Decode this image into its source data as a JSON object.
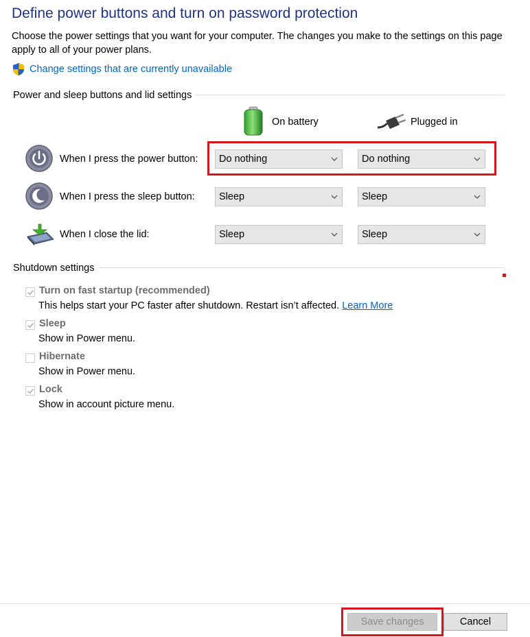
{
  "page": {
    "title": "Define power buttons and turn on password protection",
    "description": "Choose the power settings that you want for your computer. The changes you make to the settings on this page apply to all of your power plans.",
    "change_link": "Change settings that are currently unavailable"
  },
  "buttons_section": {
    "title": "Power and sleep buttons and lid settings",
    "columns": [
      "On battery",
      "Plugged in"
    ],
    "rows": [
      {
        "label": "When I press the power button:",
        "icon": "power-button-icon",
        "battery": "Do nothing",
        "plugged": "Do nothing"
      },
      {
        "label": "When I press the sleep button:",
        "icon": "sleep-button-icon",
        "battery": "Sleep",
        "plugged": "Sleep"
      },
      {
        "label": "When I close the lid:",
        "icon": "laptop-lid-icon",
        "battery": "Sleep",
        "plugged": "Sleep"
      }
    ]
  },
  "shutdown_section": {
    "title": "Shutdown settings",
    "options": [
      {
        "title": "Turn on fast startup (recommended)",
        "desc": "This helps start your PC faster after shutdown. Restart isn’t affected.",
        "link": "Learn More",
        "checked": true
      },
      {
        "title": "Sleep",
        "desc": "Show in Power menu.",
        "checked": true
      },
      {
        "title": "Hibernate",
        "desc": "Show in Power menu.",
        "checked": false
      },
      {
        "title": "Lock",
        "desc": "Show in account picture menu.",
        "checked": true
      }
    ]
  },
  "footer": {
    "save_label": "Save changes",
    "cancel_label": "Cancel"
  },
  "colors": {
    "title": "#1e3287",
    "link": "#0066cc",
    "highlight": "#d9141e"
  }
}
